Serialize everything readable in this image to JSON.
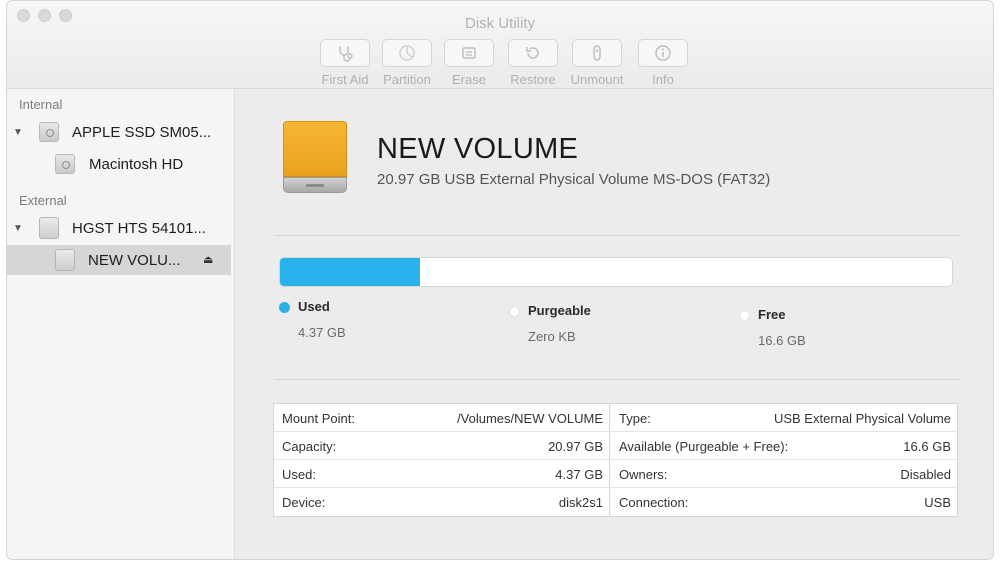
{
  "window": {
    "title": "Disk Utility"
  },
  "toolbar": {
    "items": [
      {
        "label": "First Aid",
        "icon": "stethoscope-icon"
      },
      {
        "label": "Partition",
        "icon": "partition-icon"
      },
      {
        "label": "Erase",
        "icon": "erase-icon"
      },
      {
        "label": "Restore",
        "icon": "restore-icon"
      },
      {
        "label": "Unmount",
        "icon": "unmount-icon"
      },
      {
        "label": "Info",
        "icon": "info-icon"
      }
    ]
  },
  "sidebar": {
    "internal_header": "Internal",
    "external_header": "External",
    "items": [
      {
        "label": "APPLE SSD SM05...",
        "icon": "internal-disk-icon"
      },
      {
        "label": "Macintosh HD",
        "icon": "internal-volume-icon"
      },
      {
        "label": "HGST HTS 54101...",
        "icon": "external-disk-icon"
      },
      {
        "label": "NEW VOLU...",
        "icon": "external-volume-icon",
        "selected": true
      }
    ]
  },
  "volume": {
    "name": "NEW VOLUME",
    "description": "20.97 GB USB External Physical Volume MS-DOS (FAT32)",
    "icon_color": "#f0ac2a"
  },
  "usage": {
    "used_fraction": 0.2084,
    "used_color": "#27b2ea",
    "legend": [
      {
        "name": "Used",
        "value": "4.37 GB",
        "color": "#27b2ea"
      },
      {
        "name": "Purgeable",
        "value": "Zero KB",
        "color": "#ffffff"
      },
      {
        "name": "Free",
        "value": "16.6 GB",
        "color": "#ffffff"
      }
    ]
  },
  "info": {
    "left": [
      {
        "key": "Mount Point:",
        "value": "/Volumes/NEW VOLUME"
      },
      {
        "key": "Capacity:",
        "value": "20.97 GB"
      },
      {
        "key": "Used:",
        "value": "4.37 GB"
      },
      {
        "key": "Device:",
        "value": "disk2s1"
      }
    ],
    "right": [
      {
        "key": "Type:",
        "value": "USB External Physical Volume"
      },
      {
        "key": "Available (Purgeable + Free):",
        "value": "16.6 GB"
      },
      {
        "key": "Owners:",
        "value": "Disabled"
      },
      {
        "key": "Connection:",
        "value": "USB"
      }
    ]
  }
}
